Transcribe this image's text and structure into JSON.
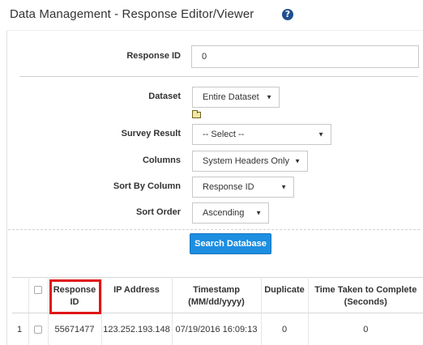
{
  "page": {
    "title": "Data Management - Response Editor/Viewer",
    "help_icon": "?"
  },
  "form": {
    "response_id": {
      "label": "Response ID",
      "value": "0"
    },
    "dataset": {
      "label": "Dataset",
      "value": "Entire Dataset"
    },
    "survey_result": {
      "label": "Survey Result",
      "value": "-- Select --"
    },
    "columns": {
      "label": "Columns",
      "value": "System Headers Only"
    },
    "sort_by_column": {
      "label": "Sort By Column",
      "value": "Response ID"
    },
    "sort_order": {
      "label": "Sort Order",
      "value": "Ascending"
    },
    "search_button": "Search Database",
    "caret": "▼"
  },
  "table": {
    "headers": [
      "",
      "",
      "Response ID",
      "IP Address",
      "Timestamp (MM/dd/yyyy)",
      "Duplicate",
      "Time Taken to Complete (Seconds)"
    ],
    "header_lines": {
      "response_id": [
        "Response",
        "ID"
      ],
      "timestamp": [
        "Timestamp",
        "(MM/dd/yyyy)"
      ],
      "time_taken": [
        "Time Taken to Complete",
        "(Seconds)"
      ]
    },
    "rows": [
      {
        "index": "1",
        "response_id": "55671477",
        "ip": "123.252.193.148",
        "timestamp": "07/19/2016 16:09:13",
        "duplicate": "0",
        "time_taken": "0"
      }
    ]
  },
  "icons": {
    "help": "question-circle-icon",
    "folder": "folder-icon",
    "caret": "caret-down-icon"
  },
  "colors": {
    "primary_button": "#1d8ee0",
    "link": "#1a5fa8",
    "highlight": "#e01515",
    "help_icon": "#1f4f8f"
  }
}
